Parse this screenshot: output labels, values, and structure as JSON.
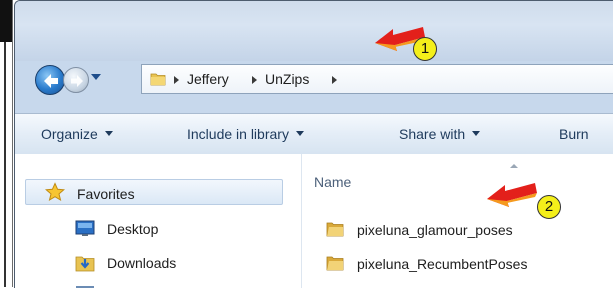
{
  "address": {
    "crumbs": [
      "Jeffery",
      "UnZips"
    ]
  },
  "toolbar": {
    "organize": "Organize",
    "include_in_library": "Include in library",
    "share_with": "Share with",
    "burn": "Burn"
  },
  "nav_pane": {
    "favorites": "Favorites",
    "items": [
      "Desktop",
      "Downloads"
    ]
  },
  "content": {
    "column_name": "Name",
    "files": [
      "pixeluna_glamour_poses",
      "pixeluna_RecumbentPoses"
    ]
  },
  "callouts": {
    "one": "1",
    "two": "2"
  },
  "colors": {
    "accent_badge": "#f4ef1a",
    "arrow_red": "#e3201b",
    "arrow_orange": "#f59a1e",
    "folder_yellow": "#e8c352"
  },
  "icons": {
    "folder": "folder-icon",
    "star": "star-icon",
    "desktop": "desktop-icon",
    "downloads": "downloads-icon",
    "back": "back-arrow-icon",
    "forward": "forward-arrow-icon",
    "callout_arrow": "red-arrow-icon"
  }
}
